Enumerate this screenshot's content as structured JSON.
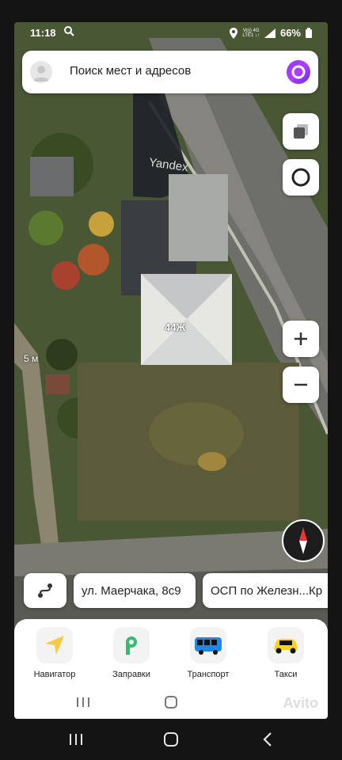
{
  "status_bar": {
    "time": "11:18",
    "net_top": "Vo)) 4G",
    "net_bottom": "LTE1 ↓↑",
    "battery": "66%"
  },
  "search": {
    "placeholder": "Поиск мест и адресов"
  },
  "map": {
    "watermark": "Yandex",
    "house_number": "44Ж",
    "scale": "5 м"
  },
  "chips": {
    "address": "ул. Маерчака, 8с9",
    "place": "ОСП по Железн...Кр"
  },
  "services": [
    {
      "label": "Навигатор",
      "icon": "navigator-icon",
      "color": "#f7c948"
    },
    {
      "label": "Заправки",
      "icon": "fuel-icon",
      "color": "#2fbf71"
    },
    {
      "label": "Транспорт",
      "icon": "bus-icon",
      "color": "#1ea7e8"
    },
    {
      "label": "Такси",
      "icon": "taxi-icon",
      "color": "#ffd21f"
    }
  ],
  "avito": "Avito",
  "colors": {
    "alice": "#8a3cff",
    "compass_red": "#e53935"
  }
}
